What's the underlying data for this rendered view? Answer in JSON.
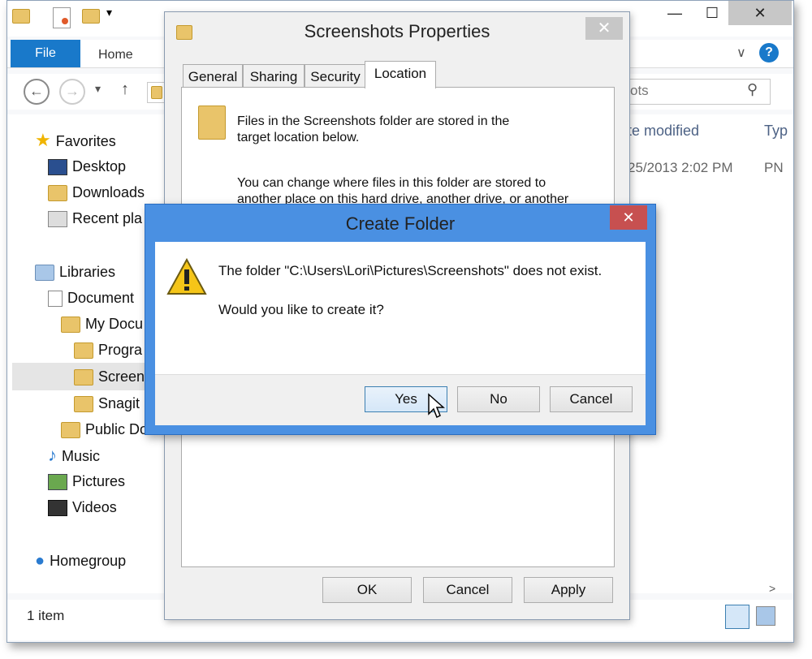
{
  "explorer": {
    "ribbon": {
      "file_tab": "File",
      "home_tab": "Home"
    },
    "search": {
      "placeholder": "ots"
    },
    "columns": {
      "date_modified": "te modified",
      "type": "Typ"
    },
    "file_row": {
      "date": "25/2013 2:02 PM",
      "type": "PN"
    },
    "nav": {
      "favorites": "Favorites",
      "desktop": "Desktop",
      "downloads": "Downloads",
      "recent": "Recent pla",
      "libraries": "Libraries",
      "documents": "Document",
      "my_documents": "My Docu",
      "programs": "Progra",
      "screenshots": "Screens",
      "snagit": "Snagit",
      "public_documents": "Public Do",
      "music": "Music",
      "pictures": "Pictures",
      "videos": "Videos",
      "homegroup": "Homegroup"
    },
    "status": {
      "item_count": "1 item"
    }
  },
  "properties_dialog": {
    "title": "Screenshots Properties",
    "tabs": [
      "General",
      "Sharing",
      "Security",
      "Location"
    ],
    "info_line1": "Files in the Screenshots folder are stored in the",
    "info_line2": "target location below.",
    "change_line1": "You can change where files in this folder are stored to",
    "change_line2": "another place on this hard drive, another drive, or another",
    "buttons": {
      "ok": "OK",
      "cancel": "Cancel",
      "apply": "Apply"
    }
  },
  "create_folder_dialog": {
    "title": "Create Folder",
    "message": "The folder \"C:\\Users\\Lori\\Pictures\\Screenshots\" does not exist.",
    "question": "Would you like to create it?",
    "buttons": {
      "yes": "Yes",
      "no": "No",
      "cancel": "Cancel"
    }
  },
  "colors": {
    "accent": "#1979ca",
    "dialog_border": "#4a90e2",
    "close_red": "#c75050"
  }
}
